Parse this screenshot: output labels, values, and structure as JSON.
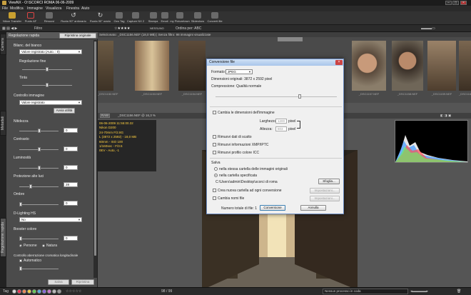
{
  "window": {
    "title": "ViewNX - O:\\SCORCI ROMA 06-06-2009"
  },
  "menu": [
    "File",
    "Modifica",
    "Immagine",
    "Visualizza",
    "Finestra",
    "Aiuto"
  ],
  "toolbar": [
    {
      "label": "Nikon Transfer",
      "icon": "nikon-transfer-icon"
    },
    {
      "label": "Punto AF",
      "icon": "af-point-icon"
    },
    {
      "label": "Rimuovi",
      "icon": "remove-icon"
    },
    {
      "label": "Ruota 90° antiorario",
      "icon": "rotate-ccw-icon"
    },
    {
      "label": "Ruota 90° orario",
      "icon": "rotate-cw-icon"
    },
    {
      "label": "Geo Tag",
      "icon": "geotag-icon"
    },
    {
      "label": "Capture NX 2",
      "icon": "capture-nx-icon"
    },
    {
      "label": "Stampa",
      "icon": "print-icon"
    },
    {
      "label": "Email",
      "icon": "email-icon"
    },
    {
      "label": "my Picturetown",
      "icon": "picturetown-icon"
    },
    {
      "label": "Slideshow",
      "icon": "slideshow-icon"
    },
    {
      "label": "Converti file",
      "icon": "convert-file-icon"
    }
  ],
  "toolbar2": {
    "filter": "Filtro",
    "rating": "☆★★★★",
    "label_none": "NESSUNO",
    "sort": "Ordina per: ABC"
  },
  "left_tabs": [
    "Camera",
    "Metadati",
    "Regolazione rapida"
  ],
  "left_panel": {
    "title": "Regolazione rapida",
    "reset": "Ripristina originale",
    "wb_label": "Bilanc. del bianco",
    "wb_value": "Valore registrato (Auto. : 0)",
    "fine_label": "Regolazione fine",
    "tint_label": "Tinta",
    "control_label": "Controllo immagine",
    "control_value": "Valore registrato",
    "apply": "Avvia utilità",
    "sliders": [
      {
        "label": "Nitidezza",
        "value": "0"
      },
      {
        "label": "Contrasto",
        "value": "0"
      },
      {
        "label": "Luminosità",
        "value": "0"
      },
      {
        "label": "Protezione alte luci",
        "value": "28"
      },
      {
        "label": "Ombre",
        "value": "0"
      }
    ],
    "dlighting_label": "D-Lighting HS",
    "dlighting_value": "No",
    "booster_label": "Booster colore",
    "booster_people": "Persone",
    "booster_nature": "Natura",
    "aberr_label": "Controllo aberrazione cromatica longitudinale",
    "aberr_auto": "Automatico",
    "save": "Salva",
    "restore": "Ripristina"
  },
  "main": {
    "info": "Selezionato: _DSC1156.NEF (18,0 MB) | Senza filtro: 98 immagini visualizzate",
    "thumb_caps": [
      "_DSC1152.NEF",
      "_DSC1153.NEF",
      "_DSC1154.NEF",
      "_DSC1155.NEF",
      "_DSC1156.NEF",
      "_DSC1157.NEF",
      "_DSC1158.NEF",
      "_DSC1159.NEF",
      "_DSC1160.NEF",
      "_DSC1161.NEF"
    ],
    "view_raw": "RAW",
    "view_file": "_DSC1156.NEF @ 16,3 %",
    "meta_lines": [
      "06-06-2009 11:55:00.32",
      "Nikon D200",
      "24-70mm F/2.8G",
      "L (3872 x 2592) - 18,0 MB",
      "60mm - ISO 100",
      "1/160sec - F/3.5",
      "0EV - Auto, -1"
    ]
  },
  "dialog": {
    "title": "Conversione file",
    "format_label": "Formato:",
    "format_value": "JPEG",
    "dims": "Dimensioni originali: 3872 x 2592 pixel",
    "compression": "Compressione: Qualità normale",
    "resize": "Cambia le dimensioni dell'immagine",
    "width_label": "Larghezza:",
    "width_value": "1200",
    "height_label": "Altezza:",
    "height_value": "803",
    "px": "pixel",
    "opt1": "Rimuovi dati di scatto",
    "opt2": "Rimuovi informazioni XMP/IPTC",
    "opt3": "Rimuovi profilo colore ICC",
    "save_label": "Salva",
    "save_opt1": "nella stessa cartella delle immagini originali",
    "save_opt2": "nella cartella specificata",
    "path": "C:\\Users\\admin\\Desktop\\scorci di roma",
    "browse": "Sfoglia...",
    "newfolder": "Crea nuova cartella ad ogni conversione",
    "rename": "Cambia nomi file",
    "settings": "Impostazioni...",
    "count": "Numero totale di file: 1",
    "convert": "Conversione",
    "cancel": "Annulla"
  },
  "status": {
    "tag": "Tag",
    "counter": "98 / 99",
    "queue": "Nessun processo in coda"
  }
}
